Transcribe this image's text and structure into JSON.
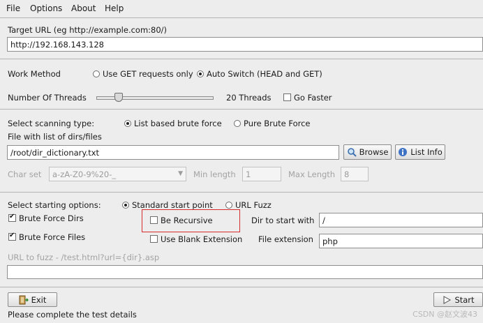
{
  "menu": [
    "File",
    "Options",
    "About",
    "Help"
  ],
  "target": {
    "label": "Target URL (eg http://example.com:80/)",
    "value": "http://192.168.143.128"
  },
  "work_method": {
    "label": "Work Method",
    "option_get": "Use GET requests only",
    "option_auto": "Auto Switch (HEAD and GET)",
    "selected": "auto"
  },
  "threads": {
    "label": "Number Of Threads",
    "value": 20,
    "value_text": "20 Threads",
    "go_faster": "Go Faster"
  },
  "scan_type": {
    "label": "Select scanning type:",
    "option_list": "List based brute force",
    "option_pure": "Pure Brute Force",
    "selected": "list"
  },
  "dirs_file": {
    "label": "File with list of dirs/files",
    "value": "/root/dir_dictionary.txt",
    "browse": "Browse",
    "list_info": "List Info"
  },
  "charset": {
    "label": "Char set",
    "value": "a-zA-Z0-9%20-_",
    "min_label": "Min length",
    "min_value": "1",
    "max_label": "Max Length",
    "max_value": "8"
  },
  "start": {
    "label": "Select starting options:",
    "option_standard": "Standard start point",
    "option_fuzz": "URL Fuzz",
    "selected": "standard",
    "brute_dirs": "Brute Force Dirs",
    "brute_files": "Brute Force Files",
    "recursive": "Be Recursive",
    "blank_ext": "Use Blank Extension",
    "dir_label": "Dir to start with",
    "dir_value": "/",
    "ext_label": "File extension",
    "ext_value": "php"
  },
  "fuzz": {
    "label": "URL to fuzz - /test.html?url={dir}.asp",
    "value": ""
  },
  "buttons": {
    "exit": "Exit",
    "start": "Start"
  },
  "status": "Please complete the test details",
  "watermark": "CSDN @赵文波43",
  "icons": {
    "exit": "exit-door-icon",
    "browse": "magnifier-icon",
    "list_info": "info-icon",
    "start": "play-arrow-icon"
  }
}
